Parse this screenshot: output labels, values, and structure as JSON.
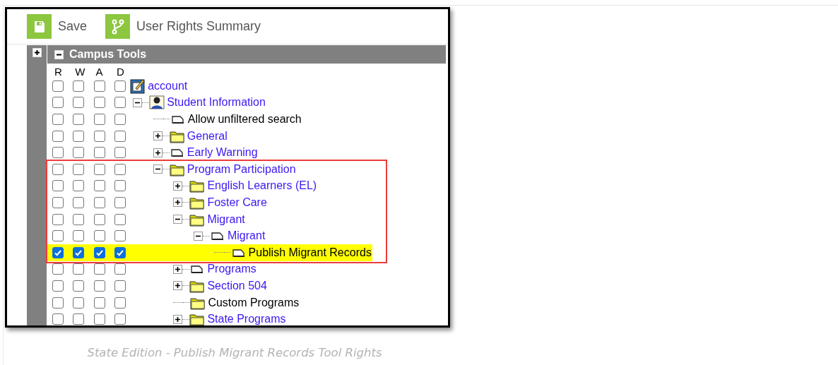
{
  "toolbar": [
    {
      "kind": "save",
      "label": "Save"
    },
    {
      "kind": "branch",
      "label": "User Rights Summary"
    }
  ],
  "side_toggle": {
    "expanded": false
  },
  "panel": {
    "title": "Campus Tools",
    "expanded": true
  },
  "columns": [
    "R",
    "W",
    "A",
    "D"
  ],
  "tree": [
    {
      "label": "account",
      "kind": "account",
      "link": true,
      "selected": false,
      "callout": false,
      "rights": [
        false,
        false,
        false,
        false
      ],
      "children": [
        {
          "label": "Student Information",
          "kind": "person",
          "link": true,
          "expanded": true,
          "selected": false,
          "callout": false,
          "rights": [
            false,
            false,
            false,
            false
          ],
          "children": [
            {
              "label": "Allow unfiltered search",
              "kind": "page",
              "link": false,
              "selected": false,
              "callout": false,
              "rights": [
                false,
                false,
                false,
                false
              ]
            },
            {
              "label": "General",
              "kind": "folder",
              "link": true,
              "expanded": false,
              "selected": false,
              "callout": false,
              "rights": [
                false,
                false,
                false,
                false
              ]
            },
            {
              "label": "Early Warning",
              "kind": "page",
              "link": true,
              "expanded": false,
              "selected": false,
              "callout": false,
              "rights": [
                false,
                false,
                false,
                false
              ]
            },
            {
              "label": "Program Participation",
              "kind": "folder",
              "link": true,
              "expanded": true,
              "selected": false,
              "callout": true,
              "rights": [
                false,
                false,
                false,
                false
              ],
              "children": [
                {
                  "label": "English Learners (EL)",
                  "kind": "folder",
                  "link": true,
                  "expanded": false,
                  "selected": false,
                  "callout": true,
                  "rights": [
                    false,
                    false,
                    false,
                    false
                  ]
                },
                {
                  "label": "Foster Care",
                  "kind": "folder",
                  "link": true,
                  "expanded": false,
                  "selected": false,
                  "callout": true,
                  "rights": [
                    false,
                    false,
                    false,
                    false
                  ]
                },
                {
                  "label": "Migrant",
                  "kind": "folder",
                  "link": true,
                  "expanded": true,
                  "selected": false,
                  "callout": true,
                  "rights": [
                    false,
                    false,
                    false,
                    false
                  ],
                  "children": [
                    {
                      "label": "Migrant",
                      "kind": "page",
                      "link": true,
                      "expanded": true,
                      "selected": false,
                      "callout": true,
                      "rights": [
                        false,
                        false,
                        false,
                        false
                      ],
                      "children": [
                        {
                          "label": "Publish Migrant Records",
                          "kind": "page",
                          "link": false,
                          "selected": true,
                          "callout": true,
                          "rights": [
                            true,
                            true,
                            true,
                            true
                          ]
                        }
                      ]
                    }
                  ]
                },
                {
                  "label": "Programs",
                  "kind": "page",
                  "link": true,
                  "expanded": false,
                  "selected": false,
                  "callout": false,
                  "rights": [
                    false,
                    false,
                    false,
                    false
                  ]
                },
                {
                  "label": "Section 504",
                  "kind": "folder",
                  "link": true,
                  "expanded": false,
                  "selected": false,
                  "callout": false,
                  "rights": [
                    false,
                    false,
                    false,
                    false
                  ]
                },
                {
                  "label": "Custom Programs",
                  "kind": "folder",
                  "link": false,
                  "selected": false,
                  "callout": false,
                  "rights": [
                    false,
                    false,
                    false,
                    false
                  ]
                },
                {
                  "label": "State Programs",
                  "kind": "folder",
                  "link": true,
                  "expanded": false,
                  "selected": false,
                  "callout": false,
                  "rights": [
                    false,
                    false,
                    false,
                    false
                  ]
                }
              ]
            }
          ]
        }
      ]
    }
  ],
  "caption": "State Edition - Publish Migrant Records Tool Rights"
}
